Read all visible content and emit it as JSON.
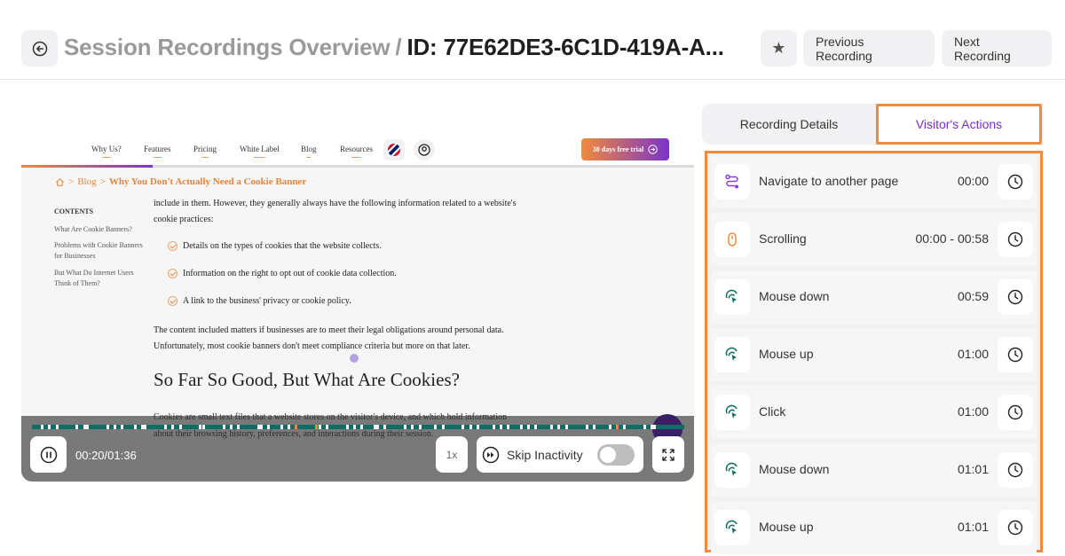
{
  "header": {
    "crumb": "Session Recordings Overview",
    "separator": "/",
    "recording_id": "ID: 77E62DE3-6C1D-419A-A...",
    "previous_label": "Previous Recording",
    "next_label": "Next Recording"
  },
  "player": {
    "site_nav": {
      "items": [
        "Why Us?",
        "Features",
        "Pricing",
        "White Label",
        "Blog",
        "Resources"
      ],
      "trial_label": "30 days free trial"
    },
    "breadcrumb": {
      "blog": "Blog",
      "current": "Why You Don't Actually Need a Cookie Banner"
    },
    "toc": {
      "title": "CONTENTS",
      "items": [
        "What Are Cookie Banners?",
        "Problems with Cookie Banners for Businesses",
        "But What Do Internet Users Think of Them?"
      ]
    },
    "article": {
      "intro": "include in them. However, they generally always have the following information related to a website's cookie practices:",
      "bullets": [
        "Details on the types of cookies that the website collects.",
        "Information on the right to opt out of cookie data collection.",
        "A link to the business' privacy or cookie policy."
      ],
      "para2": "The content included matters if businesses are to meet their legal obligations around personal data. Unfortunately, most cookie banners don't meet compliance criteria but more on that later.",
      "heading": "So Far So Good, But What Are Cookies?",
      "para3": "Cookies are small text files that a website stores on the visitor's device, and which hold information about their browsing history, preferences, and interactions during their session."
    },
    "controls": {
      "time": "00:20/01:36",
      "speed": "1x",
      "skip_label": "Skip Inactivity",
      "skip_enabled": false
    }
  },
  "panel": {
    "tabs": {
      "details": "Recording Details",
      "actions": "Visitor's Actions",
      "active": "actions"
    },
    "actions": [
      {
        "icon": "route-icon",
        "name": "Navigate to another page",
        "time": "00:00"
      },
      {
        "icon": "mouse-icon",
        "name": "Scrolling",
        "time": "00:00 - 00:58"
      },
      {
        "icon": "tap-icon",
        "name": "Mouse down",
        "time": "00:59"
      },
      {
        "icon": "tap-icon",
        "name": "Mouse up",
        "time": "01:00"
      },
      {
        "icon": "tap-icon",
        "name": "Click",
        "time": "01:00"
      },
      {
        "icon": "tap-icon",
        "name": "Mouse down",
        "time": "01:01"
      },
      {
        "icon": "tap-icon",
        "name": "Mouse up",
        "time": "01:01"
      }
    ]
  },
  "colors": {
    "accent_orange": "#f08a3c",
    "accent_purple": "#7b2bd4",
    "timeline_green": "#0f6d63"
  }
}
